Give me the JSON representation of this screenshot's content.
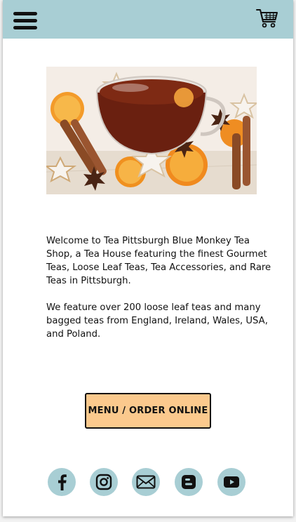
{
  "header": {
    "menu_icon": "hamburger-menu-icon",
    "cart_icon": "shopping-cart-icon",
    "background_color": "#a8ced4"
  },
  "hero": {
    "image": "tea-cup-with-cinnamon-orange-and-star-cookies"
  },
  "intro": {
    "paragraph_1": "Welcome to Tea Pittsburgh Blue Monkey Tea Shop, a Tea House featuring the finest Gourmet Teas, Loose Leaf Teas, Tea Accessories, and Rare Teas in Pittsburgh.",
    "paragraph_2": "We feature over 200 loose leaf teas and many bagged teas from England, Ireland, Wales, USA, and Poland."
  },
  "cta": {
    "label": "MENU / ORDER ONLINE",
    "color": "#fbc98d"
  },
  "social": [
    {
      "icon": "facebook-icon"
    },
    {
      "icon": "instagram-icon"
    },
    {
      "icon": "email-icon"
    },
    {
      "icon": "blogger-icon"
    },
    {
      "icon": "youtube-icon"
    }
  ]
}
